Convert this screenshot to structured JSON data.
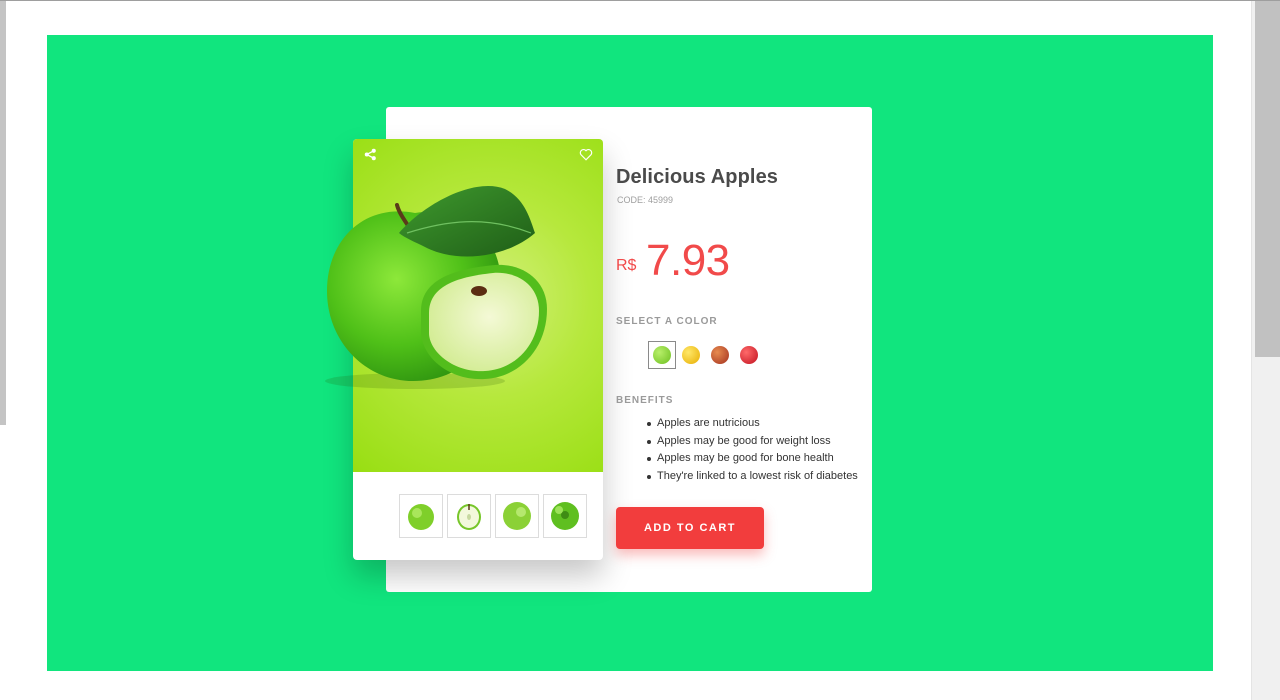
{
  "product": {
    "title": "Delicious Apples",
    "code": "CODE: 45999",
    "currency": "R$",
    "price": "7.93",
    "price_color": "#f14a4a"
  },
  "icons": {
    "share": "share-icon",
    "favorite": "heart-icon"
  },
  "thumbnails": [
    "whole green apple",
    "apple half",
    "green apple",
    "green apple top"
  ],
  "colors": {
    "label": "SELECT A COLOR",
    "options": [
      {
        "name": "green",
        "hex": "#7fd12e",
        "selected": true
      },
      {
        "name": "yellow",
        "hex": "#f2c315",
        "selected": false
      },
      {
        "name": "red-brown",
        "hex": "#c0482a",
        "selected": false
      },
      {
        "name": "red",
        "hex": "#d9182a",
        "selected": false
      }
    ]
  },
  "benefits": {
    "label": "BENEFITS",
    "items": [
      "Apples are nutricious",
      "Apples may be good for weight loss",
      "Apples may be good for bone health",
      "They're linked to a lowest risk of diabetes"
    ]
  },
  "cart": {
    "label": "ADD TO CART"
  },
  "theme": {
    "background": "#11e57e",
    "accent": "#f23d3d"
  }
}
